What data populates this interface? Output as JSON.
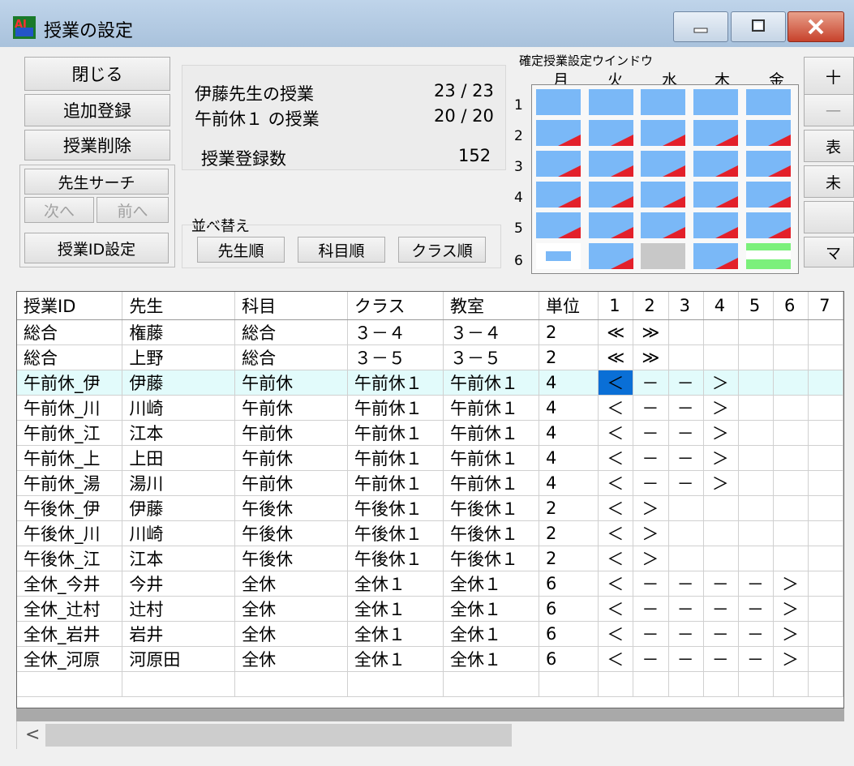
{
  "window": {
    "title": "授業の設定"
  },
  "buttons": {
    "close": "閉じる",
    "add": "追加登録",
    "delete": "授業削除",
    "teacher_search": "先生サーチ",
    "next": "次へ",
    "prev": "前へ",
    "id_setting": "授業ID設定"
  },
  "info": {
    "teacher_label": "伊藤先生の授業",
    "teacher_count": "23 / 23",
    "class_label": "午前休１ の授業",
    "class_count": "20 / 20",
    "total_label": "授業登録数",
    "total_count": "152"
  },
  "sort": {
    "label": "並べ替え",
    "by_teacher": "先生順",
    "by_subject": "科目順",
    "by_class": "クラス順"
  },
  "schedule": {
    "title": "確定授業設定ウインドウ",
    "days": [
      "月",
      "火",
      "水",
      "木",
      "金"
    ],
    "periods": [
      "1",
      "2",
      "3",
      "4",
      "5",
      "6"
    ]
  },
  "right_buttons": [
    "十",
    "一",
    "表",
    "未",
    "",
    "マ"
  ],
  "table": {
    "headers": [
      "授業ID",
      "先生",
      "科目",
      "クラス",
      "教室",
      "単位",
      "1",
      "2",
      "3",
      "4",
      "5",
      "6",
      "7"
    ],
    "rows": [
      [
        "総合",
        "権藤",
        "総合",
        "３－４",
        "３－４",
        "2",
        "≪",
        "≫",
        "",
        "",
        "",
        "",
        ""
      ],
      [
        "総合",
        "上野",
        "総合",
        "３－５",
        "３－５",
        "2",
        "≪",
        "≫",
        "",
        "",
        "",
        "",
        ""
      ],
      [
        "午前休_伊",
        "伊藤",
        "午前休",
        "午前休１",
        "午前休１",
        "4",
        "＜",
        "－",
        "－",
        "＞",
        "",
        "",
        ""
      ],
      [
        "午前休_川",
        "川崎",
        "午前休",
        "午前休１",
        "午前休１",
        "4",
        "＜",
        "－",
        "－",
        "＞",
        "",
        "",
        ""
      ],
      [
        "午前休_江",
        "江本",
        "午前休",
        "午前休１",
        "午前休１",
        "4",
        "＜",
        "－",
        "－",
        "＞",
        "",
        "",
        ""
      ],
      [
        "午前休_上",
        "上田",
        "午前休",
        "午前休１",
        "午前休１",
        "4",
        "＜",
        "－",
        "－",
        "＞",
        "",
        "",
        ""
      ],
      [
        "午前休_湯",
        "湯川",
        "午前休",
        "午前休１",
        "午前休１",
        "4",
        "＜",
        "－",
        "－",
        "＞",
        "",
        "",
        ""
      ],
      [
        "午後休_伊",
        "伊藤",
        "午後休",
        "午後休１",
        "午後休１",
        "2",
        "＜",
        "＞",
        "",
        "",
        "",
        "",
        ""
      ],
      [
        "午後休_川",
        "川崎",
        "午後休",
        "午後休１",
        "午後休１",
        "2",
        "＜",
        "＞",
        "",
        "",
        "",
        "",
        ""
      ],
      [
        "午後休_江",
        "江本",
        "午後休",
        "午後休１",
        "午後休１",
        "2",
        "＜",
        "＞",
        "",
        "",
        "",
        "",
        ""
      ],
      [
        "全休_今井",
        "今井",
        "全休",
        "全休１",
        "全休１",
        "6",
        "＜",
        "－",
        "－",
        "－",
        "－",
        "＞",
        ""
      ],
      [
        "全休_辻村",
        "辻村",
        "全休",
        "全休１",
        "全休１",
        "6",
        "＜",
        "－",
        "－",
        "－",
        "－",
        "＞",
        ""
      ],
      [
        "全休_岩井",
        "岩井",
        "全休",
        "全休１",
        "全休１",
        "6",
        "＜",
        "－",
        "－",
        "－",
        "－",
        "＞",
        ""
      ],
      [
        "全休_河原",
        "河原田",
        "全休",
        "全休１",
        "全休１",
        "6",
        "＜",
        "－",
        "－",
        "－",
        "－",
        "＞",
        ""
      ],
      [
        "",
        "",
        "",
        "",
        "",
        "",
        "",
        "",
        "",
        "",
        "",
        "",
        ""
      ]
    ]
  },
  "colors": {
    "accent": "#0a6fd6",
    "cell_blue": "#7ab8f7",
    "corner_red": "#e3202a",
    "green_text": "#1a8a1a",
    "green_bar": "#7bf07b"
  }
}
